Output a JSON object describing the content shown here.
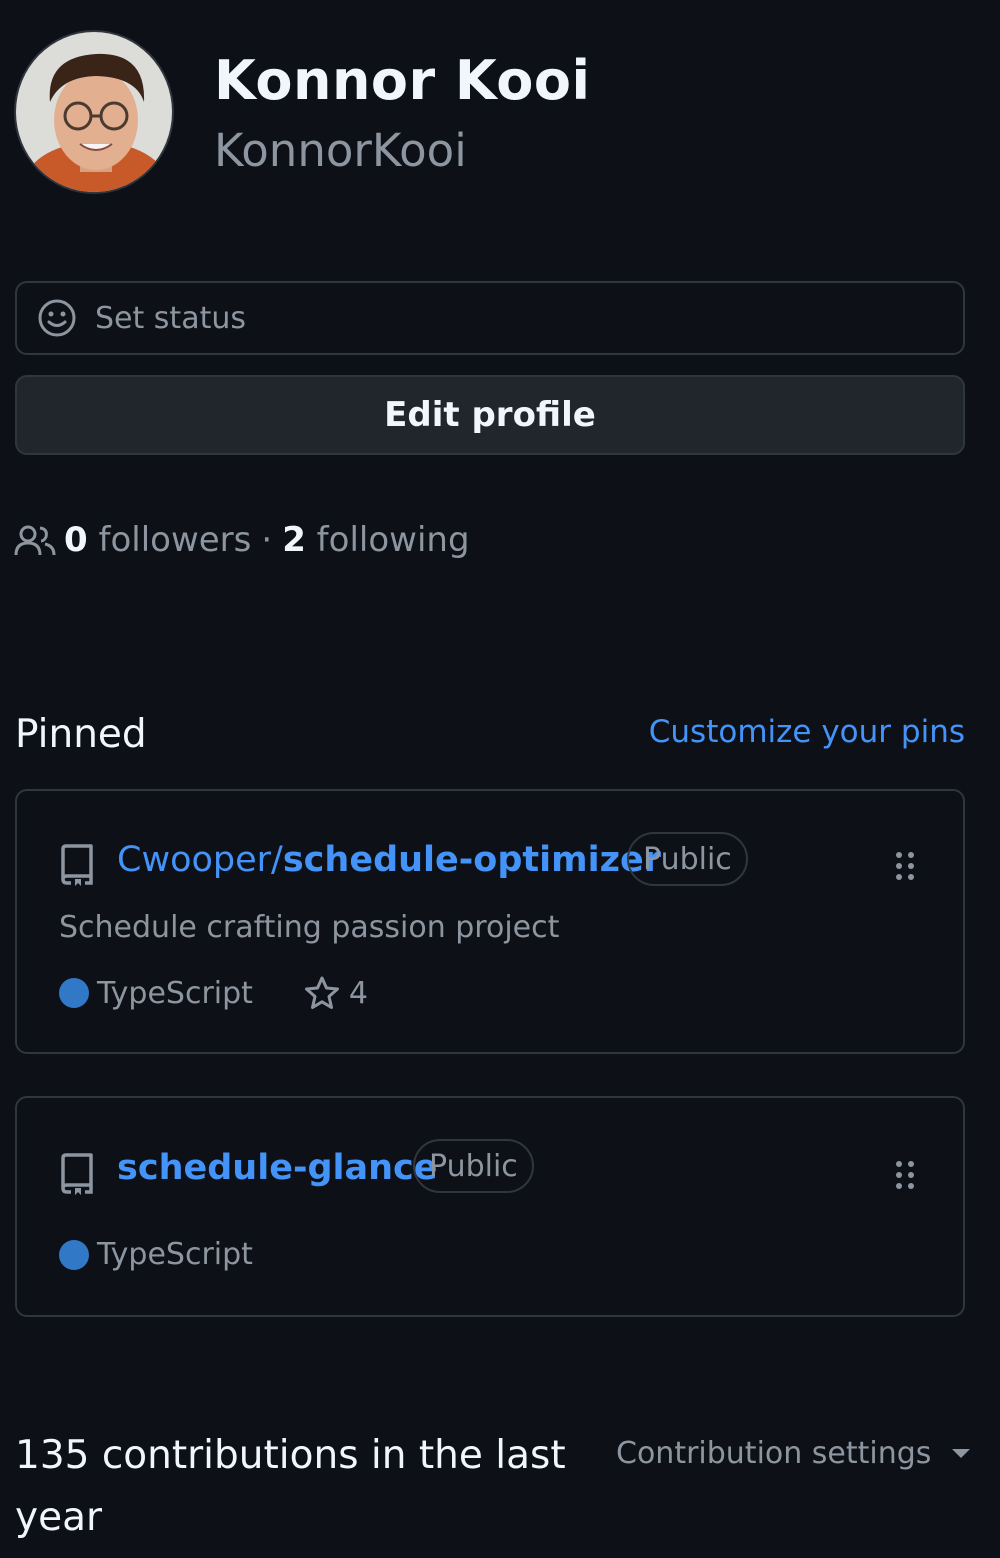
{
  "profile": {
    "full_name": "Konnor Kooi",
    "username": "KonnorKooi"
  },
  "status_button": {
    "label": "Set status",
    "icon": "smiley-icon"
  },
  "edit_profile_button": {
    "label": "Edit profile"
  },
  "social": {
    "icon": "people-icon",
    "followers_count": "0",
    "followers_label": "followers",
    "separator": "·",
    "following_count": "2",
    "following_label": "following"
  },
  "pinned": {
    "title": "Pinned",
    "customize_link": "Customize your pins",
    "repos": [
      {
        "owner": "Cwooper/",
        "name": "schedule-optimizer",
        "visibility": "Public",
        "description": "Schedule crafting passion project",
        "language": "TypeScript",
        "stars": "4"
      },
      {
        "owner": "",
        "name": "schedule-glance",
        "visibility": "Public",
        "description": "",
        "language": "TypeScript",
        "stars": ""
      }
    ]
  },
  "contributions": {
    "title": "135 contributions in the last year",
    "settings_label": "Contribution settings"
  },
  "colors": {
    "background": "#0d1117",
    "link": "#4493f8",
    "muted": "#8d96a0",
    "border": "#30363d",
    "typescript": "#3178c6"
  }
}
